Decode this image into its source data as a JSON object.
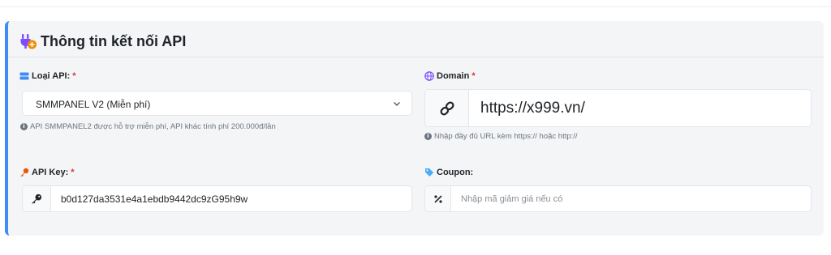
{
  "card": {
    "title": "Thông tin kết nối API",
    "title_icon": "plug-add-icon",
    "accent_color": "#3f8cf7"
  },
  "api_type": {
    "label": "Loại API:",
    "required_mark": "*",
    "icon": "server-icon",
    "selected": "SMMPANEL V2 (Miễn phí)",
    "hint": "API SMMPANEL2 được hỗ trợ miễn phí, API khác tính phí 200.000đ/lần"
  },
  "domain": {
    "label": "Domain",
    "required_mark": "*",
    "icon": "globe-icon",
    "value": "https://x999.vn/",
    "addon_icon": "link-icon",
    "hint": "Nhập đầy đủ URL kèm https:// hoặc http://"
  },
  "api_key": {
    "label": "API Key:",
    "required_mark": "*",
    "icon": "key-icon",
    "value": "b0d127da3531e4a1ebdb9442dc9zG95h9w",
    "addon_icon": "key-solid-icon"
  },
  "coupon": {
    "label": "Coupon:",
    "icon": "tag-icon",
    "placeholder": "Nhập mã giảm giá nếu có",
    "addon_icon": "percent-icon"
  }
}
